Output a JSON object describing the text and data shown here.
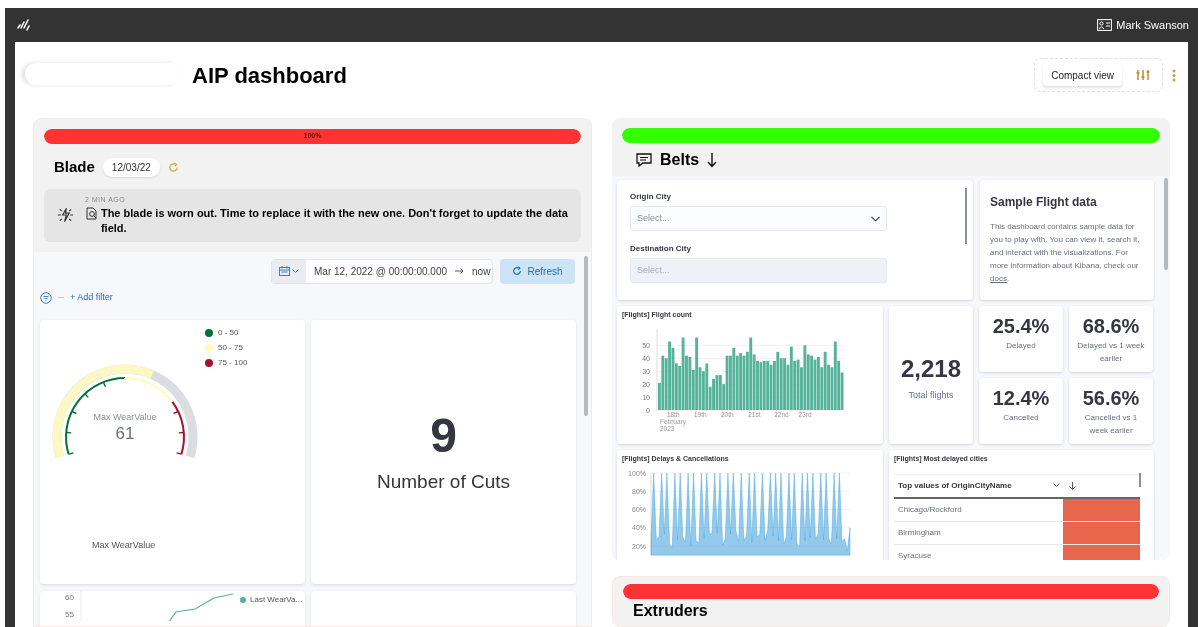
{
  "app_bar": {
    "user": "Mark Swanson"
  },
  "header": {
    "title": "AIP dashboard",
    "compact_view": "Compact view"
  },
  "panels": [
    {
      "kind": "blade",
      "status": {
        "level": 1,
        "label": "100%",
        "color": "#ff3333"
      },
      "title": "Blade",
      "date": "12/03/22",
      "alert": {
        "time": "2 MIN AGO",
        "message": "The blade is worn out. Time to replace it with the new one. Don't forget to update the data field."
      },
      "time_picker": {
        "start": "Mar 12, 2022 @ 00:00:00.000",
        "end": "now"
      },
      "refresh": "Refresh",
      "add_filter": "+ Add filter",
      "gauge": {
        "title": "Max WearValue",
        "value": "61",
        "caption": "Max WearValue",
        "legend": [
          {
            "label": "0 - 50",
            "color": "#00733b"
          },
          {
            "label": "50 - 75",
            "color": "#fffbbd"
          },
          {
            "label": "75 - 100",
            "color": "#a8102d"
          }
        ]
      },
      "metric": {
        "value": "9",
        "label": "Number of Cuts"
      },
      "line_chart": {
        "axis_labels": [
          "60",
          "55"
        ],
        "legend": {
          "label": "Last WearVa...",
          "color": "#54b399"
        }
      }
    },
    {
      "kind": "belts",
      "status": {
        "level": 1,
        "color": "#33ff00"
      },
      "title": "Belts",
      "controls": [
        {
          "label": "Origin City",
          "placeholder": "Select...",
          "disabled": false
        },
        {
          "label": "Destination City",
          "placeholder": "Select...",
          "disabled": true
        }
      ],
      "info": {
        "title": "Sample Flight data",
        "text": "This dashboard contains sample data for you to play with. You can view it, search it, and interact with the visualizations. For more information about Kibana, check our ",
        "link": "docs",
        "after": "."
      },
      "flight_count": {
        "title": "[Flights] Flight count",
        "chart_data": {
          "type": "bar",
          "xlabel": "February 2023",
          "ylim": [
            0,
            58
          ],
          "yticks": [
            0,
            10,
            20,
            30,
            40,
            50
          ],
          "grid": true,
          "categories": [
            null,
            null,
            null,
            null,
            "18th",
            null,
            null,
            null,
            null,
            null,
            null,
            null,
            "19th",
            null,
            null,
            null,
            null,
            null,
            null,
            null,
            "20th",
            null,
            null,
            null,
            null,
            null,
            null,
            null,
            "21st",
            null,
            null,
            null,
            null,
            null,
            null,
            null,
            "22nd",
            null,
            null,
            null,
            null,
            null,
            null,
            "23rd",
            null,
            null,
            null,
            null,
            null,
            null,
            null,
            null,
            null,
            null,
            null
          ],
          "series": [
            {
              "color": "#54b399",
              "values": [
                21,
                42,
                40,
                53,
                48,
                36,
                34,
                56,
                42,
                41,
                31,
                56,
                33,
                30,
                36,
                18,
                24,
                27,
                27,
                20,
                42,
                42,
                48,
                42,
                44,
                42,
                45,
                56,
                43,
                38,
                37,
                38,
                38,
                35,
                38,
                45,
                40,
                40,
                35,
                49,
                38,
                39,
                33,
                50,
                43,
                42,
                39,
                41,
                33,
                45,
                35,
                33,
                53,
                38,
                29
              ]
            }
          ]
        }
      },
      "total": {
        "value": "2,218",
        "label": "Total flights"
      },
      "metrics": [
        {
          "value": "25.4%",
          "label": "Delayed"
        },
        {
          "value": "68.6%",
          "label": "Delayed vs 1 week earlier"
        },
        {
          "value": "12.4%",
          "label": "Cancelled"
        },
        {
          "value": "56.6%",
          "label": "Cancelled vs 1 week earlier"
        }
      ],
      "delays": {
        "title": "[Flights] Delays & Cancellations",
        "chart_data": {
          "type": "area",
          "grid": true,
          "ylim": [
            10,
            100
          ],
          "yticks": [
            {
              "value": 20,
              "label": "20%"
            },
            {
              "value": 40,
              "label": "40%"
            },
            {
              "value": 60,
              "label": "60%"
            },
            {
              "value": 80,
              "label": "80%"
            },
            {
              "value": 100,
              "label": "100%"
            }
          ],
          "series": [
            {
              "color": "#3a9fdc",
              "values": [
                28,
                100,
                27,
                30,
                100,
                33,
                100,
                22,
                18,
                100,
                27,
                100,
                30,
                24,
                100,
                20,
                100,
                26,
                23,
                100,
                28,
                100,
                33,
                34,
                100,
                34,
                100,
                21,
                28,
                100,
                33,
                100,
                37,
                25,
                100,
                26,
                31,
                100,
                24,
                100,
                30,
                33,
                100,
                26,
                37,
                100,
                31,
                100,
                26,
                100,
                22,
                30,
                100,
                27,
                100,
                23,
                19,
                100,
                26,
                100,
                29,
                100,
                28,
                33,
                100,
                27,
                100,
                28,
                22,
                100,
                28,
                100,
                25,
                28,
                15,
                40
              ]
            }
          ]
        }
      },
      "cities": {
        "title": "[Flights] Most delayed cities",
        "column": "Top values of OriginCityName",
        "rows": [
          "Chicago/Rockford",
          "Birmingham",
          "Syracuse"
        ]
      }
    },
    {
      "kind": "extruders",
      "status": {
        "level": 1,
        "color": "#ff3333"
      },
      "title": "Extruders"
    }
  ]
}
